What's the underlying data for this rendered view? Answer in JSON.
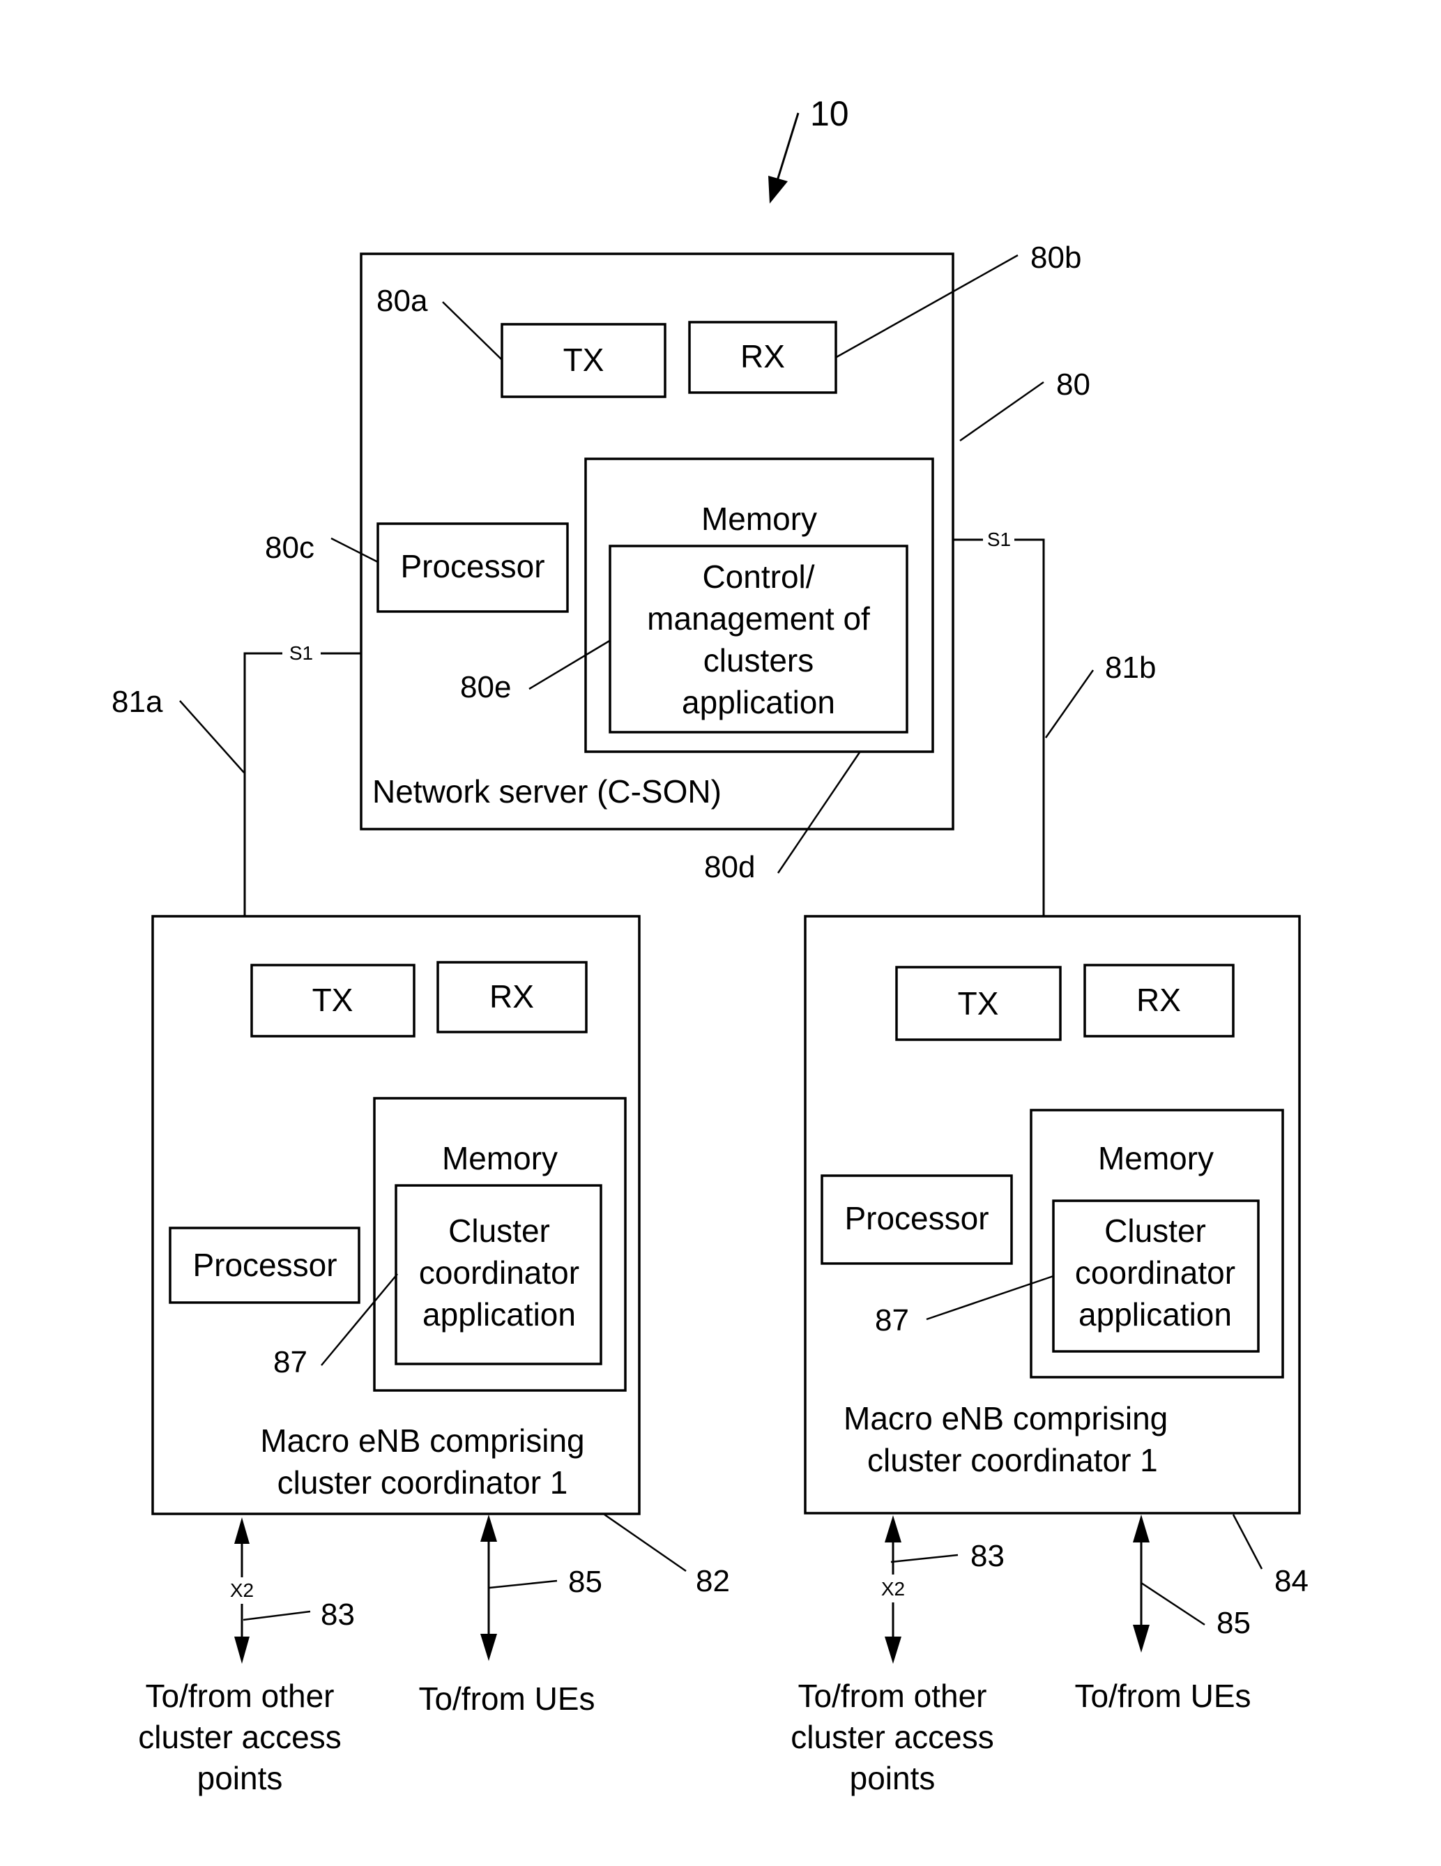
{
  "figure": {
    "ref_system": "10",
    "colors": {
      "ink": "#000000",
      "background": "#ffffff"
    }
  },
  "server": {
    "ref": "80",
    "label": "Network server (C-SON)",
    "tx": {
      "label": "TX",
      "ref": "80a"
    },
    "rx": {
      "label": "RX",
      "ref": "80b"
    },
    "processor": {
      "label": "Processor",
      "ref": "80c"
    },
    "memory": {
      "label": "Memory",
      "ref": "80d",
      "app": {
        "ref": "80e",
        "lines": [
          "Control/",
          "management of",
          "clusters",
          "application"
        ]
      }
    }
  },
  "links": {
    "left_s1": {
      "label": "S1",
      "ref": "81a"
    },
    "right_s1": {
      "label": "S1",
      "ref": "81b"
    }
  },
  "enb_left": {
    "ref": "82",
    "caption_lines": [
      "Macro eNB comprising",
      "cluster coordinator 1"
    ],
    "tx": {
      "label": "TX"
    },
    "rx": {
      "label": "RX"
    },
    "processor": {
      "label": "Processor"
    },
    "memory": {
      "label": "Memory",
      "app": {
        "ref": "87",
        "lines": [
          "Cluster",
          "coordinator",
          "application"
        ]
      }
    },
    "x2": {
      "label": "X2",
      "ref": "83",
      "caption_lines": [
        "To/from other",
        "cluster access",
        "points"
      ]
    },
    "ue": {
      "ref": "85",
      "caption": "To/from UEs"
    }
  },
  "enb_right": {
    "ref": "84",
    "caption_lines": [
      "Macro eNB comprising",
      "cluster coordinator 1"
    ],
    "tx": {
      "label": "TX"
    },
    "rx": {
      "label": "RX"
    },
    "processor": {
      "label": "Processor"
    },
    "memory": {
      "label": "Memory",
      "app": {
        "ref": "87",
        "lines": [
          "Cluster",
          "coordinator",
          "application"
        ]
      }
    },
    "x2": {
      "label": "X2",
      "ref": "83",
      "caption_lines": [
        "To/from other",
        "cluster access",
        "points"
      ]
    },
    "ue": {
      "ref": "85",
      "caption": "To/from UEs"
    }
  }
}
